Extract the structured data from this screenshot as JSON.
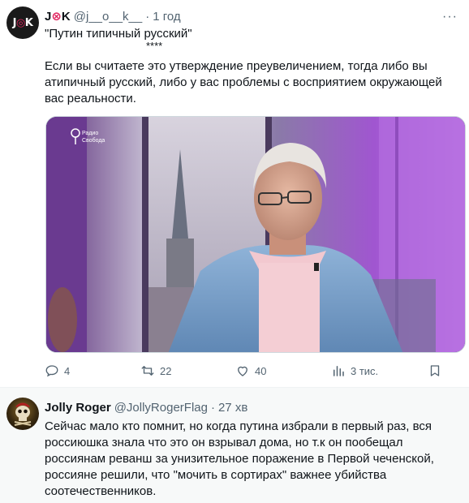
{
  "tweet1": {
    "author_name_prefix": "J",
    "author_name_suffix": "K",
    "avatar_text_prefix": "J",
    "avatar_text_suffix": "K",
    "handle": "@j__o__k__",
    "time": "1 год",
    "quote_line": "\"Путин типичный русский\"",
    "stars": "****",
    "paragraph": "Если вы считаете это утверждение преувеличением, тогда либо вы атипичный русский, либо у вас проблемы с восприятием окружающей вас реальности.",
    "media_watermark_line1": "Радио",
    "media_watermark_line2": "Свобода",
    "stats": {
      "replies": "4",
      "retweets": "22",
      "likes": "40",
      "views": "3 тис."
    }
  },
  "tweet2": {
    "author_name": "Jolly Roger",
    "handle": "@JollyRogerFlag",
    "time": "27 хв",
    "body": "Сейчас мало кто помнит, но когда путина избрали в первый раз, вся россиюшка знала что это он взрывал дома, но т.к он пообещал россиянам реванш за унизительное поражение в Первой чеченской, россияне решили, что \"мочить в сортирах\" важнее убийства соотечественников."
  },
  "colors": {
    "secondary_text": "#536471",
    "accent": "#e0245e",
    "background": "#ffffff",
    "reply_background": "#f7f9f9"
  },
  "icons": {
    "reply": "speech-bubble-icon",
    "retweet": "retweet-icon",
    "like": "heart-icon",
    "views": "bar-chart-icon",
    "bookmark": "bookmark-icon",
    "more": "ellipsis-icon"
  }
}
